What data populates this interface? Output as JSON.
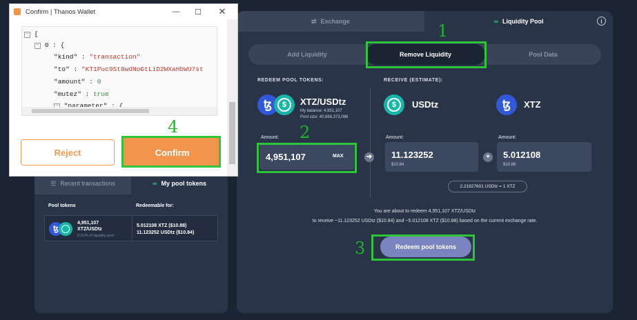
{
  "main": {
    "tabs": {
      "exchange": "Exchange",
      "liquidity_pool": "Liquidity Pool"
    },
    "subtabs": {
      "add": "Add Liquidity",
      "remove": "Remove Liquidity",
      "pool_data": "Pool Data"
    },
    "redeem_label": "REDEEM POOL TOKENS:",
    "receive_label": "RECEIVE (ESTIMATE):",
    "pool_token": {
      "name": "XTZ/USDtz",
      "balance": "My balance: 4,951,107",
      "pool_size": "Pool size: 40,888,373,086"
    },
    "receive_tokens": [
      "USDtz",
      "XTZ"
    ],
    "amount_label": "Amount:",
    "redeem_amount": "4,951,107",
    "max_label": "MAX",
    "usdtz_amount": "11.123252",
    "usdtz_value": "$10.84",
    "xtz_amount": "5.012108",
    "xtz_value": "$10.88",
    "rate": "2.21927601 USDtz = 1 XTZ",
    "note_line1": "You are about to redeem 4,951,107 XTZ/USDtz",
    "note_line2": "to receive ~11.123252 USDtz ($10.84) and ~5.012108 XTZ ($10.88) based on the current exchange rate.",
    "redeem_button": "Redeem pool tokens"
  },
  "markers": {
    "one": "1",
    "two": "2",
    "three": "3",
    "four": "4"
  },
  "left_panel": {
    "tabs": {
      "recent": "Recent transactions",
      "pool": "My pool tokens"
    },
    "col_pool_tokens": "Pool tokens",
    "col_redeemable": "Redeemable for:",
    "row": {
      "amount": "4,951,107",
      "pair": "XTZ/USDtz",
      "share": "0.01% of liquidity pool",
      "xtz": "5.012108 XTZ ($10.88)",
      "usdtz": "11.123252 USDtz ($10.84)"
    }
  },
  "wallet": {
    "title": "Confirm | Thanos Wallet",
    "code": {
      "open_bracket": "[",
      "index": "0 : {",
      "kind_key": "\"kind\"",
      "kind_val": "\"transaction\"",
      "to_key": "\"to\"",
      "to_val": "\"KT1Puc9St8wdNoGtLiD2WXaHbWU7st",
      "amount_key": "\"amount\"",
      "amount_val": "0",
      "mutez_key": "\"mutez\"",
      "mutez_val": "true",
      "param_key": "\"parameter\"",
      "param_val": "{",
      "sep": " : "
    },
    "reject": "Reject",
    "confirm": "Confirm"
  },
  "colors": {
    "accent_green": "#2ec53a",
    "confirm_orange": "#f2954c",
    "panel": "#2a3448",
    "background": "#1b2433"
  }
}
